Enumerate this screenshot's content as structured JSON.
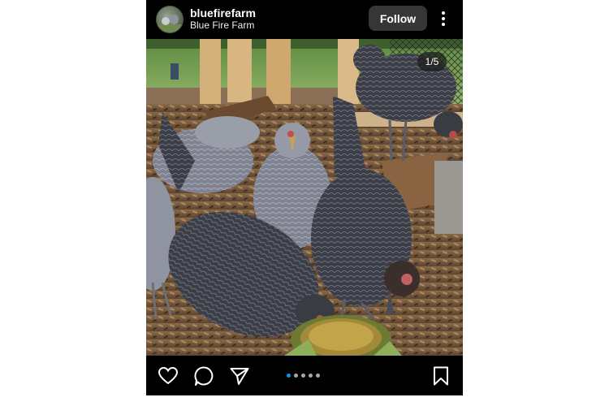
{
  "post": {
    "username": "bluefirefarm",
    "subtitle": "Blue Fire Farm",
    "follow_label": "Follow",
    "image_counter": "1/5",
    "carousel": {
      "total": 5,
      "active_index": 0
    }
  },
  "icons": {
    "more": "more-vertical-icon",
    "like": "heart-icon",
    "comment": "comment-icon",
    "share": "send-icon",
    "save": "bookmark-icon"
  },
  "colors": {
    "background": "#000000",
    "follow_button": "#363636",
    "active_dot": "#0095f6",
    "inactive_dot": "#a8a8a8"
  }
}
